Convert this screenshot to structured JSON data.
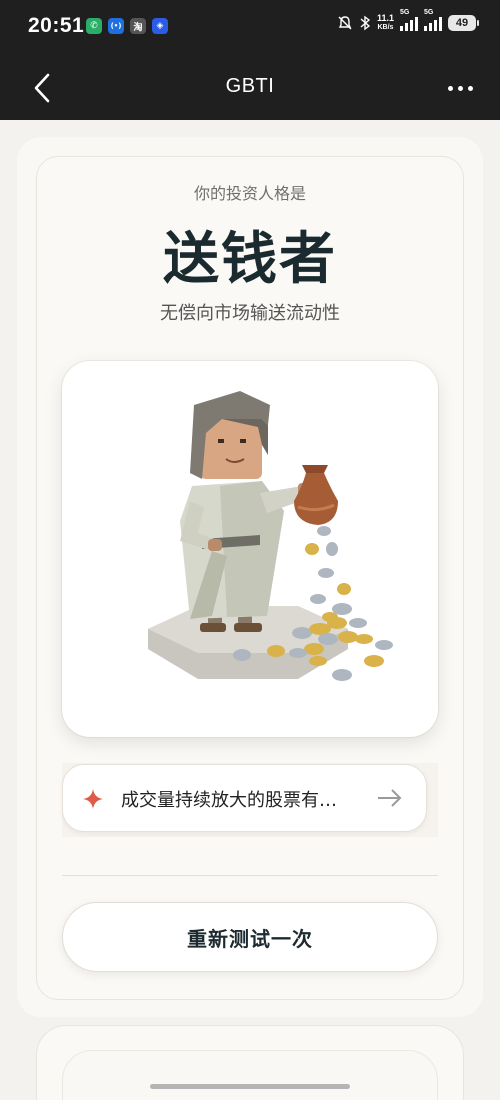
{
  "status_bar": {
    "time": "20:51",
    "app_icons": [
      {
        "name": "wechat-icon",
        "glyph": "✆",
        "color": "#2aae67"
      },
      {
        "name": "hotspot-icon",
        "glyph": "((·))",
        "color": "#1e6fe0"
      },
      {
        "name": "taobao-icon",
        "glyph": "淘",
        "color": "#444444"
      },
      {
        "name": "app-icon",
        "glyph": "◈",
        "color": "#2b5ce6"
      }
    ],
    "network_speed_value": "11.1",
    "network_speed_unit": "KB/s",
    "signal_1_label": "5G",
    "signal_2_label": "5G",
    "battery": "49"
  },
  "nav": {
    "title": "GBTI"
  },
  "result": {
    "subtitle": "你的投资人格是",
    "persona": "送钱者",
    "description": "无偿向市场输送流动性"
  },
  "tip": {
    "text": "成交量持续放大的股票有…"
  },
  "actions": {
    "retest_label": "重新测试一次"
  },
  "colors": {
    "header_bg": "#1f1f1f",
    "title_text": "#1b2a2e",
    "sparkle": "#e05a4a",
    "coin_gold": "#d9b24a",
    "coin_silver": "#aeb6bf"
  }
}
